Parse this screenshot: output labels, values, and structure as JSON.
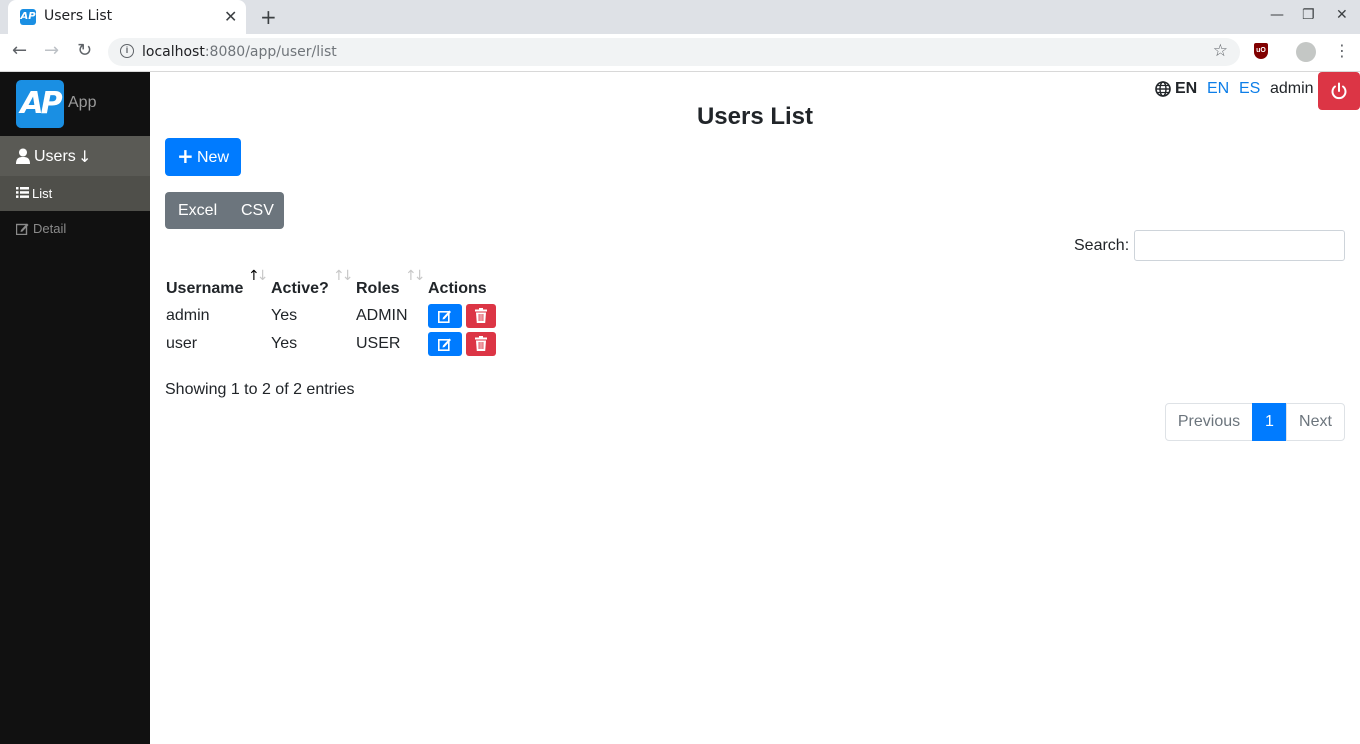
{
  "browser": {
    "tab_title": "Users List",
    "tab_close": "✕",
    "new_tab": "+",
    "url_host": "localhost",
    "url_rest": ":8080/app/user/list",
    "controls": {
      "minimize": "—",
      "restore": "❐",
      "close": "✕"
    }
  },
  "sidebar": {
    "logo_mark": "AP",
    "app_name": "App",
    "menu": {
      "users_label": "Users",
      "users_arrow": "↓",
      "list_label": "List",
      "detail_label": "Detail"
    }
  },
  "header": {
    "current_lang": "EN",
    "lang_options": [
      "EN",
      "ES"
    ],
    "username": "admin"
  },
  "page": {
    "title": "Users List",
    "new_button": "New",
    "export_buttons": [
      "Excel",
      "CSV"
    ],
    "search_label": "Search:",
    "search_value": ""
  },
  "table": {
    "columns": [
      "Username",
      "Active?",
      "Roles",
      "Actions"
    ],
    "sorted_column": "Username",
    "rows": [
      {
        "username": "admin",
        "active": "Yes",
        "roles": "ADMIN"
      },
      {
        "username": "user",
        "active": "Yes",
        "roles": "USER"
      }
    ]
  },
  "footer": {
    "info": "Showing 1 to 2 of 2 entries",
    "pagination": {
      "previous": "Previous",
      "current": "1",
      "next": "Next"
    }
  },
  "colors": {
    "primary": "#007bff",
    "danger": "#dc3545",
    "secondary": "#6c757d",
    "sidebar_bg": "#111111",
    "link": "#0d7ee8"
  }
}
